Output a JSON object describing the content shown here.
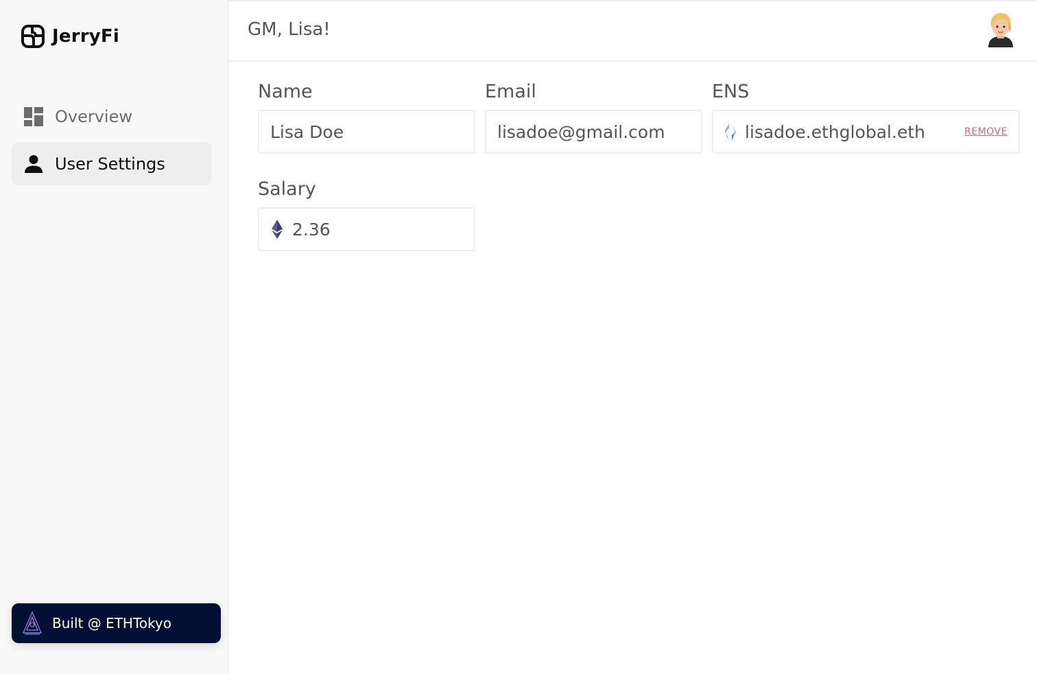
{
  "brand": {
    "name": "JerryFi"
  },
  "sidebar": {
    "items": [
      {
        "label": "Overview",
        "icon": "dashboard-icon",
        "active": false
      },
      {
        "label": "User Settings",
        "icon": "user-icon",
        "active": true
      }
    ],
    "badge": {
      "label": "Built @ ETHTokyo",
      "icon": "ethtokyo-logo-icon"
    }
  },
  "header": {
    "greeting": "GM, Lisa!",
    "avatar": "avatar"
  },
  "form": {
    "name": {
      "label": "Name",
      "value": "Lisa Doe"
    },
    "email": {
      "label": "Email",
      "value": "lisadoe@gmail.com"
    },
    "ens": {
      "label": "ENS",
      "value": "lisadoe.ethglobal.eth",
      "action": "REMOVE",
      "icon": "ens-icon"
    },
    "salary": {
      "label": "Salary",
      "value": "2.36",
      "icon": "ethereum-icon"
    }
  },
  "colors": {
    "sidebar_bg": "#f8f8f8",
    "active_item_bg": "#eeeeee",
    "badge_bg": "#040f36",
    "remove_link": "#e0607e",
    "ens_blue": "#4c8cf5"
  }
}
